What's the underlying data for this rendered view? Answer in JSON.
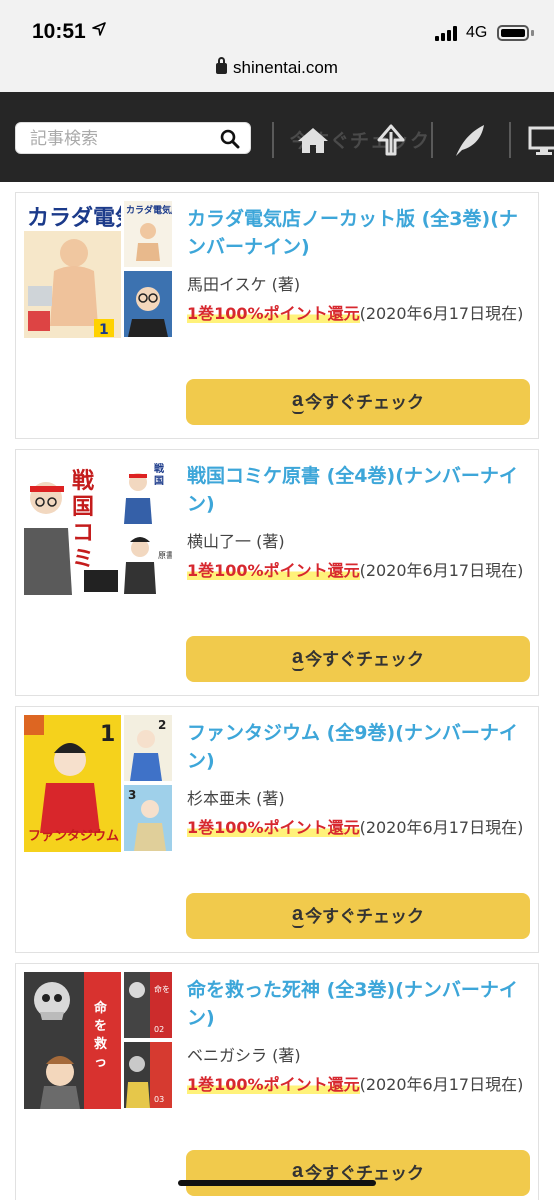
{
  "status": {
    "time": "10:51",
    "network": "4G"
  },
  "browser": {
    "url": "shinentai.com"
  },
  "header": {
    "search_placeholder": "記事検索",
    "ghost_text": "今すぐチェック",
    "icons": [
      "home-icon",
      "arrow-up-icon",
      "feather-icon",
      "monitor-icon"
    ]
  },
  "colors": {
    "title": "#3da6d9",
    "button": "#f1ca4c",
    "point": "#d7282f",
    "header_bg": "#262626"
  },
  "products": [
    {
      "title": "カラダ電気店ノーカット版 (全3巻)(ナンバーナイン)",
      "author": "馬田イスケ (著)",
      "point_highlight": "1巻100%ポイント還元",
      "point_note": "(2020年6月17日現在)",
      "button_label": "今すぐチェック",
      "amazon_mark": "a"
    },
    {
      "title": "戦国コミケ原書 (全4巻)(ナンバーナイン)",
      "author": "横山了一 (著)",
      "point_highlight": "1巻100%ポイント還元",
      "point_note": "(2020年6月17日現在)",
      "button_label": "今すぐチェック",
      "amazon_mark": "a"
    },
    {
      "title": "ファンタジウム (全9巻)(ナンバーナイン)",
      "author": "杉本亜未 (著)",
      "point_highlight": "1巻100%ポイント還元",
      "point_note": "(2020年6月17日現在)",
      "button_label": "今すぐチェック",
      "amazon_mark": "a"
    },
    {
      "title": "命を救った死神 (全3巻)(ナンバーナイン)",
      "author": "ベニガシラ (著)",
      "point_highlight": "1巻100%ポイント還元",
      "point_note": "(2020年6月17日現在)",
      "button_label": "今すぐチェック",
      "amazon_mark": "a"
    }
  ]
}
